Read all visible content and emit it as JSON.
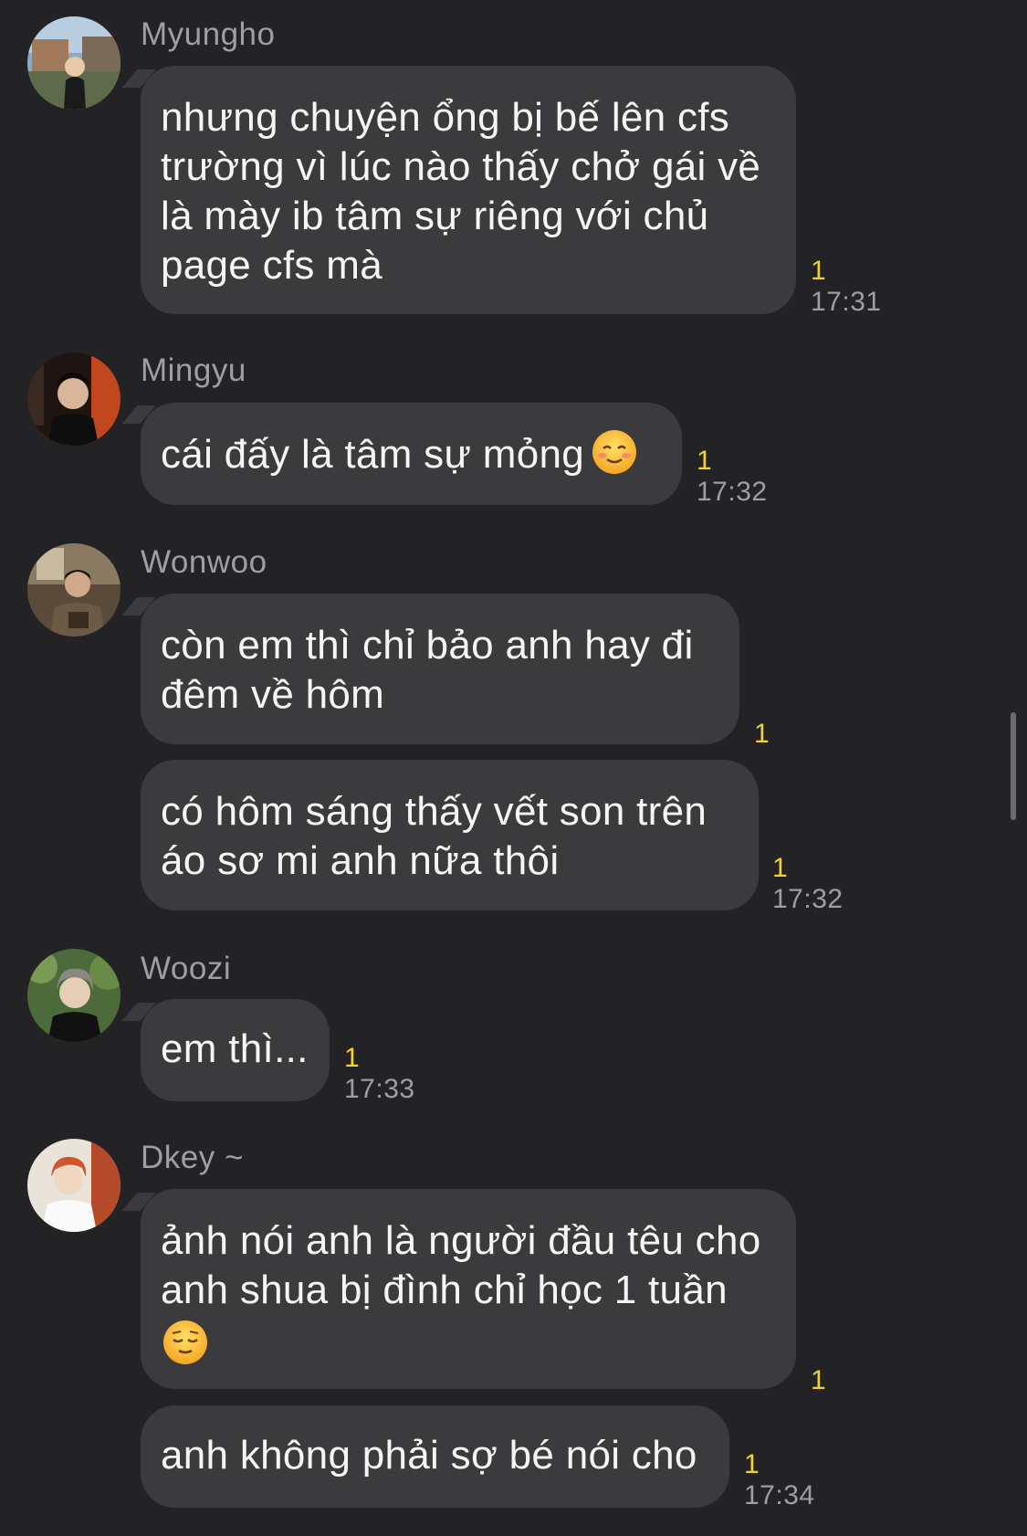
{
  "messages": [
    {
      "sender": "Myungho",
      "bubbles": [
        {
          "lines": [
            "nhưng chuyện ổng bị bế lên cfs",
            "trường vì lúc nào thấy chở gái về",
            "là mày ib tâm sự riêng với chủ",
            "page cfs mà"
          ],
          "unread": "1",
          "time": "17:31"
        }
      ]
    },
    {
      "sender": "Mingyu",
      "bubbles": [
        {
          "lines": [
            "cái đấy là tâm sự mỏng"
          ],
          "emoji": "smiling-face-icon",
          "unread": "1",
          "time": "17:32"
        }
      ]
    },
    {
      "sender": "Wonwoo",
      "bubbles": [
        {
          "lines": [
            "còn em thì chỉ bảo anh hay đi",
            "đêm về hôm"
          ],
          "unread": "1",
          "time": ""
        },
        {
          "lines": [
            "có hôm sáng thấy vết son trên",
            "áo sơ mi anh nữa thôi"
          ],
          "unread": "1",
          "time": "17:32"
        }
      ]
    },
    {
      "sender": "Woozi",
      "bubbles": [
        {
          "lines": [
            "em thì..."
          ],
          "unread": "1",
          "time": "17:33"
        }
      ]
    },
    {
      "sender": "Dkey ~",
      "bubbles": [
        {
          "lines": [
            "ảnh nói anh là người đầu têu cho",
            "anh shua bị đình chỉ học 1 tuần"
          ],
          "emoji": "relieved-face-icon",
          "unread": "1",
          "time": ""
        },
        {
          "lines": [
            "anh không phải sợ bé nói cho"
          ],
          "unread": "1",
          "time": "17:34"
        }
      ]
    }
  ],
  "colors": {
    "background": "#232325",
    "bubble": "#3b3b3e",
    "unread": "#f3d22b",
    "meta_text": "#9e9ea3"
  }
}
